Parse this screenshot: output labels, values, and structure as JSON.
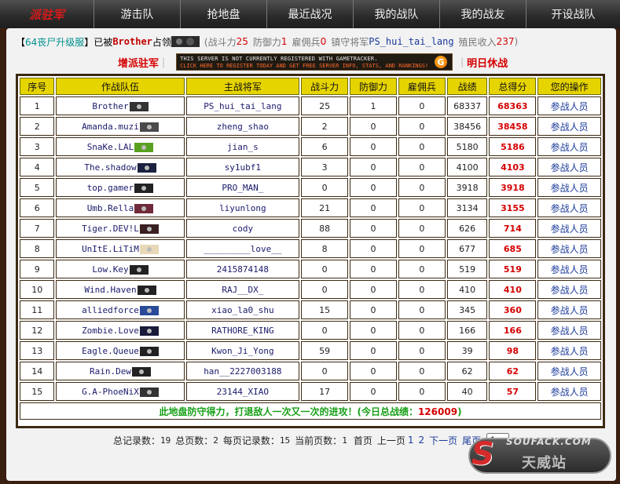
{
  "nav": {
    "items": [
      {
        "label": "派驻军"
      },
      {
        "label": "游击队"
      },
      {
        "label": "抢地盘"
      },
      {
        "label": "最近战况"
      },
      {
        "label": "我的战队"
      },
      {
        "label": "我的战友"
      },
      {
        "label": "开设战队"
      }
    ]
  },
  "announce": {
    "open": "【",
    "server": "64丧尸升级服",
    "close": "】",
    "occupied_by": "已被",
    "clan": "Brother",
    "occupy_word": "占领",
    "power_label": "(战斗力",
    "power_value": "25",
    "defense_label": "防御力",
    "defense_value": "1",
    "merc_label": "雇佣兵",
    "merc_value": "0",
    "guard_label": "镇守将军",
    "guard_value": "PS_hui_tai_lang",
    "income_label": "殖民收入",
    "income_value": "237",
    "end": ")"
  },
  "actions": {
    "left": "增派驻军",
    "right": "明日休战",
    "banner_line1": "THIS SERVER IS NOT CURRENTLY REGISTERED WITH GAMETRACKER.",
    "banner_line2": "CLICK HERE TO REGISTER TODAY AND GET FREE SERVER INFO, STATS, AND RANKINGS!",
    "banner_icon": "G"
  },
  "table": {
    "headers": [
      "序号",
      "作战队伍",
      "主战将军",
      "战斗力",
      "防御力",
      "雇佣兵",
      "战绩",
      "总得分",
      "您的操作"
    ],
    "rows": [
      {
        "no": "1",
        "team": "Brother",
        "general": "PS_hui_tai_lang",
        "power": "25",
        "defense": "1",
        "merc": "0",
        "record": "68337",
        "score": "68363",
        "op": "参战人员",
        "logo": "#333"
      },
      {
        "no": "2",
        "team": "Amanda.muzi",
        "general": "zheng_shao",
        "power": "2",
        "defense": "0",
        "merc": "0",
        "record": "38456",
        "score": "38458",
        "op": "参战人员",
        "logo": "#4a4a4a"
      },
      {
        "no": "3",
        "team": "SnaKe.LAL",
        "general": "jian_s",
        "power": "6",
        "defense": "0",
        "merc": "0",
        "record": "5180",
        "score": "5186",
        "op": "参战人员",
        "logo": "#5aa020"
      },
      {
        "no": "4",
        "team": "The.shadow",
        "general": "sy1ubf1",
        "power": "3",
        "defense": "0",
        "merc": "0",
        "record": "4100",
        "score": "4103",
        "op": "参战人员",
        "logo": "#1b2240"
      },
      {
        "no": "5",
        "team": "top.gamer",
        "general": "PRO_MAN_",
        "power": "0",
        "defense": "0",
        "merc": "0",
        "record": "3918",
        "score": "3918",
        "op": "参战人员",
        "logo": "#222"
      },
      {
        "no": "6",
        "team": "Umb.Rella",
        "general": "liyunlong",
        "power": "21",
        "defense": "0",
        "merc": "0",
        "record": "3134",
        "score": "3155",
        "op": "参战人员",
        "logo": "#702a3a"
      },
      {
        "no": "7",
        "team": "Tiger.DEV!L",
        "general": "cody",
        "power": "88",
        "defense": "0",
        "merc": "0",
        "record": "626",
        "score": "714",
        "op": "参战人员",
        "logo": "#3a2020"
      },
      {
        "no": "8",
        "team": "UnItE.LiTiM",
        "general": "_________love__",
        "power": "8",
        "defense": "0",
        "merc": "0",
        "record": "677",
        "score": "685",
        "op": "参战人员",
        "logo": "#e8d8b8"
      },
      {
        "no": "9",
        "team": "Low.Key",
        "general": "2415874148",
        "power": "0",
        "defense": "0",
        "merc": "0",
        "record": "519",
        "score": "519",
        "op": "参战人员",
        "logo": "#222"
      },
      {
        "no": "10",
        "team": "Wind.Haven",
        "general": "RAJ__DX_",
        "power": "0",
        "defense": "0",
        "merc": "0",
        "record": "410",
        "score": "410",
        "op": "参战人员",
        "logo": "#222"
      },
      {
        "no": "11",
        "team": "alliedforce",
        "general": "xiao_la0_shu",
        "power": "15",
        "defense": "0",
        "merc": "0",
        "record": "345",
        "score": "360",
        "op": "参战人员",
        "logo": "#2a4a9a"
      },
      {
        "no": "12",
        "team": "Zombie.Love",
        "general": "RATHORE_KING",
        "power": "0",
        "defense": "0",
        "merc": "0",
        "record": "166",
        "score": "166",
        "op": "参战人员",
        "logo": "#1a1a3a"
      },
      {
        "no": "13",
        "team": "Eagle.Queue",
        "general": "Kwon_Ji_Yong",
        "power": "59",
        "defense": "0",
        "merc": "0",
        "record": "39",
        "score": "98",
        "op": "参战人员",
        "logo": "#222"
      },
      {
        "no": "14",
        "team": "Rain.Dew",
        "general": "han__2227003188",
        "power": "0",
        "defense": "0",
        "merc": "0",
        "record": "62",
        "score": "62",
        "op": "参战人员",
        "logo": "#222"
      },
      {
        "no": "15",
        "team": "G.A-PhoeNiX",
        "general": "23144_XIAO",
        "power": "17",
        "defense": "0",
        "merc": "0",
        "record": "40",
        "score": "57",
        "op": "参战人员",
        "logo": "#333"
      }
    ],
    "footer_text": "此地盘防守得力，打退敌人一次又一次的进攻！(今日总战绩：",
    "footer_total": "126009",
    "footer_end": ")"
  },
  "pager": {
    "total_label": "总记录数：",
    "total": "19",
    "pages_label": "总页数：",
    "pages": "2",
    "per_label": "每页记录数：",
    "per": "15",
    "current_label": "当前页数：",
    "current": "1",
    "first": "首页",
    "prev": "上一页",
    "p1": "1",
    "p2": "2",
    "next": "下一页",
    "last": "尾页",
    "select_value": "1"
  },
  "watermark": {
    "s": "S",
    "top": "SOUFACK.COM",
    "bottom": "天威站"
  }
}
